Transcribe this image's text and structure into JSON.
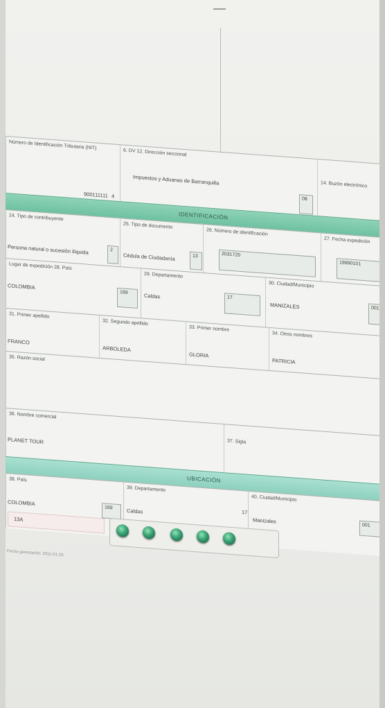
{
  "header": {
    "field_nit_label": "Número de Identificación Tributaria (NIT)",
    "field_nit_value": "900111111",
    "field_nit_dv": "4",
    "field_nombre_label": "6. DV  12. Dirección seccional",
    "field_nombre_value": "Impuestos y Aduanas de Barranquilla",
    "field_nombre_code": "08",
    "field_buzon_label": "14. Buzón electrónico"
  },
  "section_identificacion": {
    "title": "IDENTIFICACIÓN",
    "tipo_contribuyente_label": "24. Tipo de contribuyente",
    "tipo_contribuyente_value": "Persona natural o sucesión ilíquida",
    "tipo_contribuyente_code": "2",
    "tipo_documento_label": "25. Tipo de documento",
    "tipo_documento_value": "Cédula de Ciudadanía",
    "tipo_documento_code": "13",
    "numero_id_label": "26. Número de identificación",
    "numero_id_value": "2031720",
    "fecha_exp_label": "27. Fecha expedición",
    "fecha_exp_value": "19990101",
    "lugar_exp_label": "Lugar de expedición   28. País",
    "lugar_exp_value": "COLOMBIA",
    "lugar_exp_code": "169",
    "depto_label": "29. Departamento",
    "depto_value": "Caldas",
    "depto_code": "17",
    "ciudad_label": "30. Ciudad/Municipio",
    "ciudad_value": "MANIZALES",
    "ciudad_code": "001",
    "primer_apellido_label": "31. Primer apellido",
    "primer_apellido_value": "FRANCO",
    "segundo_apellido_label": "32. Segundo apellido",
    "segundo_apellido_value": "ARBOLEDA",
    "primer_nombre_label": "33. Primer nombre",
    "primer_nombre_value": "GLORIA",
    "otros_nombres_label": "34. Otros nombres",
    "otros_nombres_value": "PATRICIA",
    "razon_social_label": "35. Razón social",
    "nombre_comercial_label": "36. Nombre comercial",
    "nombre_comercial_value": "PLANET TOUR",
    "sigla_label": "37. Sigla"
  },
  "section_ubicacion": {
    "title": "UBICACIÓN",
    "pais_label": "38. País",
    "pais_value": "COLOMBIA",
    "pais_code": "169",
    "depto_label": "39. Departamento",
    "depto_value": "Caldas",
    "depto_code": "17",
    "ciudad_label": "40. Ciudad/Municipio",
    "ciudad_value": "Manizales",
    "ciudad_code": "001",
    "row_value": "13A"
  },
  "footnote": "Fecha generación: 2011-01-23"
}
